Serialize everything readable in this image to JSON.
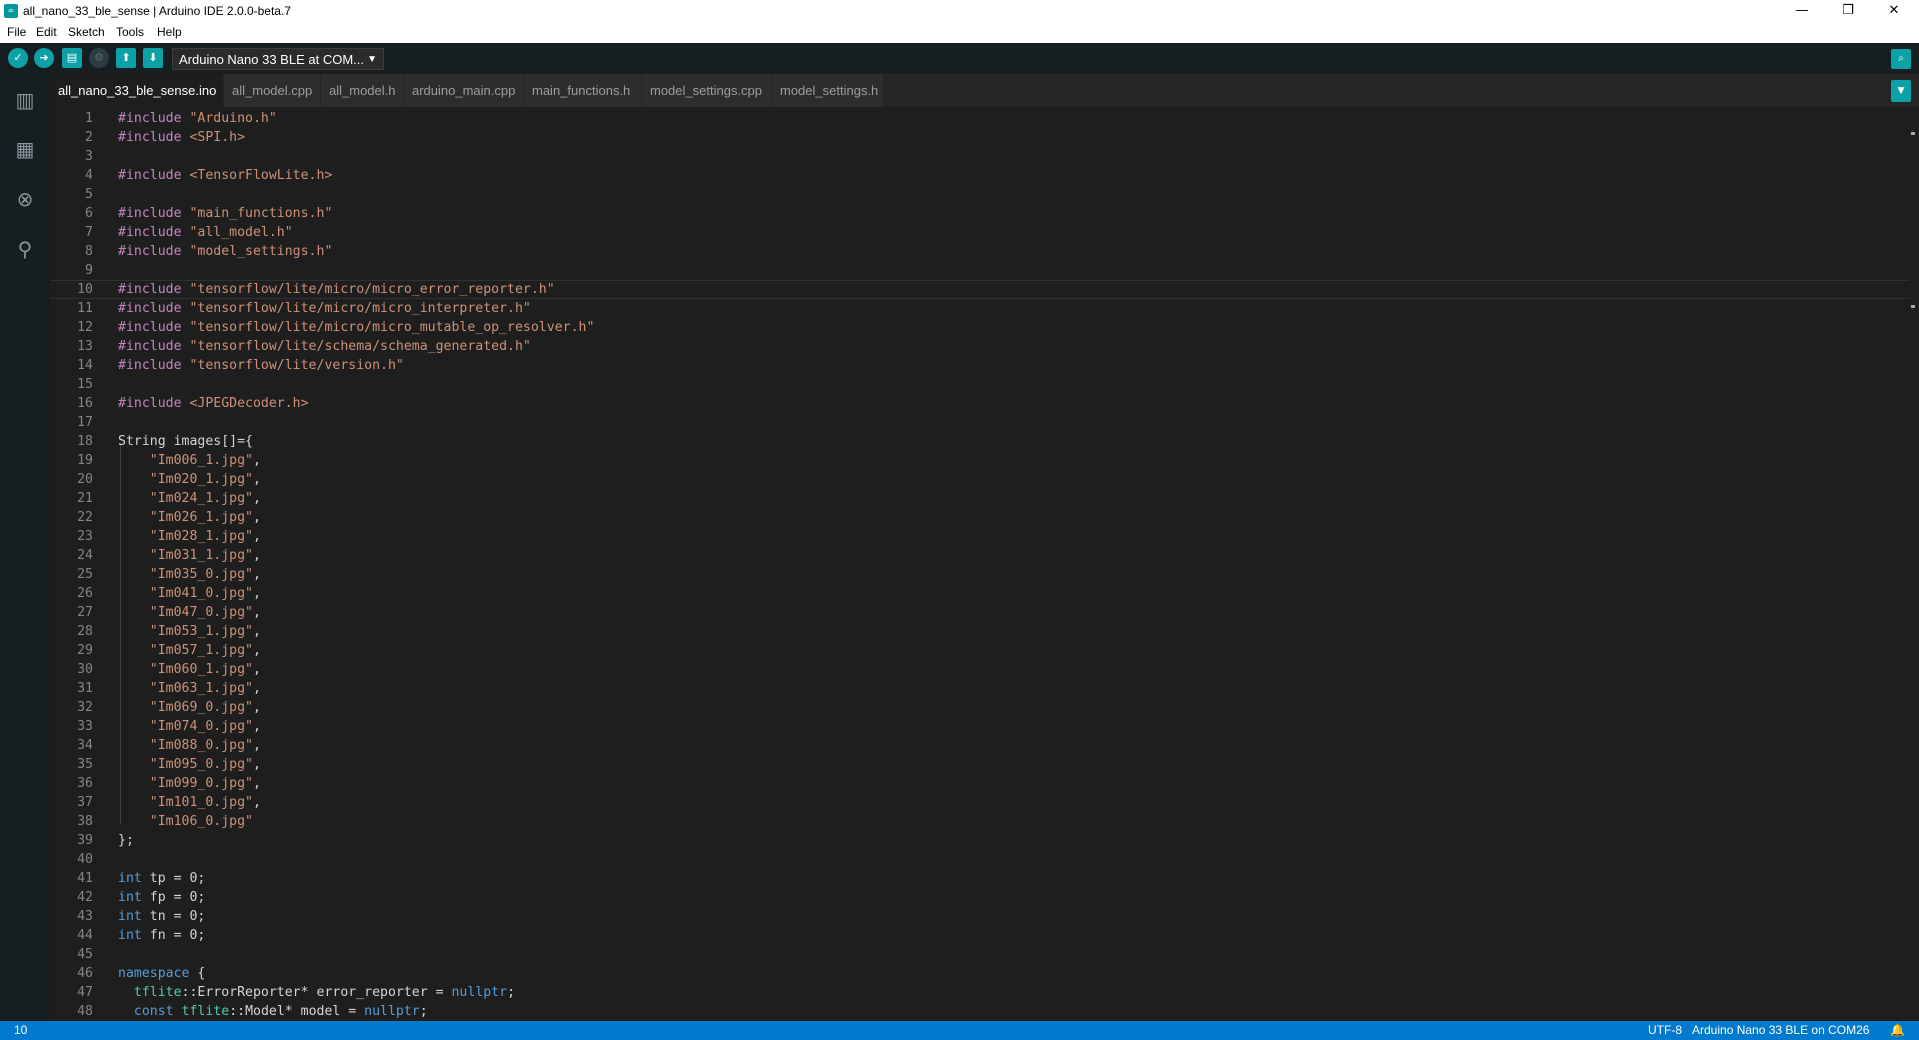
{
  "window": {
    "title": "all_nano_33_ble_sense | Arduino IDE 2.0.0-beta.7",
    "app_icon_text": "∞",
    "controls": [
      "—",
      "❐",
      "✕"
    ]
  },
  "menu": [
    "File",
    "Edit",
    "Sketch",
    "Tools",
    "Help"
  ],
  "toolbar": {
    "board_selector": "Arduino Nano 33 BLE at COM...",
    "caret": "▼"
  },
  "tabs": [
    {
      "label": "all_nano_33_ble_sense.ino",
      "active": true
    },
    {
      "label": "all_model.cpp",
      "active": false
    },
    {
      "label": "all_model.h",
      "active": false
    },
    {
      "label": "arduino_main.cpp",
      "active": false
    },
    {
      "label": "main_functions.h",
      "active": false
    },
    {
      "label": "model_settings.cpp",
      "active": false
    },
    {
      "label": "model_settings.h",
      "active": false
    }
  ],
  "editor": {
    "current_line": 10,
    "lines": [
      {
        "n": "1",
        "parts": [
          [
            "kw",
            "#include "
          ],
          [
            "str",
            "\"Arduino.h\""
          ]
        ]
      },
      {
        "n": "2",
        "parts": [
          [
            "kw",
            "#include "
          ],
          [
            "str",
            "<SPI.h>"
          ]
        ]
      },
      {
        "n": "3",
        "parts": []
      },
      {
        "n": "4",
        "parts": [
          [
            "kw",
            "#include "
          ],
          [
            "str",
            "<TensorFlowLite.h>"
          ]
        ]
      },
      {
        "n": "5",
        "parts": []
      },
      {
        "n": "6",
        "parts": [
          [
            "kw",
            "#include "
          ],
          [
            "str",
            "\"main_functions.h\""
          ]
        ]
      },
      {
        "n": "7",
        "parts": [
          [
            "kw",
            "#include "
          ],
          [
            "str",
            "\"all_model.h\""
          ]
        ]
      },
      {
        "n": "8",
        "parts": [
          [
            "kw",
            "#include "
          ],
          [
            "str",
            "\"model_settings.h\""
          ]
        ]
      },
      {
        "n": "9",
        "parts": []
      },
      {
        "n": "10",
        "parts": [
          [
            "kw",
            "#include "
          ],
          [
            "str",
            "\"tensorflow/lite/micro/micro_error_reporter.h\""
          ]
        ]
      },
      {
        "n": "11",
        "parts": [
          [
            "kw",
            "#include "
          ],
          [
            "str",
            "\"tensorflow/lite/micro/micro_interpreter.h\""
          ]
        ]
      },
      {
        "n": "12",
        "parts": [
          [
            "kw",
            "#include "
          ],
          [
            "str",
            "\"tensorflow/lite/micro/micro_mutable_op_resolver.h\""
          ]
        ]
      },
      {
        "n": "13",
        "parts": [
          [
            "kw",
            "#include "
          ],
          [
            "str",
            "\"tensorflow/lite/schema/schema_generated.h\""
          ]
        ]
      },
      {
        "n": "14",
        "parts": [
          [
            "kw",
            "#include "
          ],
          [
            "str",
            "\"tensorflow/lite/version.h\""
          ]
        ]
      },
      {
        "n": "15",
        "parts": []
      },
      {
        "n": "16",
        "parts": [
          [
            "kw",
            "#include "
          ],
          [
            "str",
            "<JPEGDecoder.h>"
          ]
        ]
      },
      {
        "n": "17",
        "parts": []
      },
      {
        "n": "18",
        "parts": [
          [
            "pl",
            "String images[]={"
          ]
        ]
      },
      {
        "n": "19",
        "parts": [
          [
            "pl",
            "    "
          ],
          [
            "str",
            "\"Im006_1.jpg\""
          ],
          [
            "pl",
            ","
          ]
        ]
      },
      {
        "n": "20",
        "parts": [
          [
            "pl",
            "    "
          ],
          [
            "str",
            "\"Im020_1.jpg\""
          ],
          [
            "pl",
            ","
          ]
        ]
      },
      {
        "n": "21",
        "parts": [
          [
            "pl",
            "    "
          ],
          [
            "str",
            "\"Im024_1.jpg\""
          ],
          [
            "pl",
            ","
          ]
        ]
      },
      {
        "n": "22",
        "parts": [
          [
            "pl",
            "    "
          ],
          [
            "str",
            "\"Im026_1.jpg\""
          ],
          [
            "pl",
            ","
          ]
        ]
      },
      {
        "n": "23",
        "parts": [
          [
            "pl",
            "    "
          ],
          [
            "str",
            "\"Im028_1.jpg\""
          ],
          [
            "pl",
            ","
          ]
        ]
      },
      {
        "n": "24",
        "parts": [
          [
            "pl",
            "    "
          ],
          [
            "str",
            "\"Im031_1.jpg\""
          ],
          [
            "pl",
            ","
          ]
        ]
      },
      {
        "n": "25",
        "parts": [
          [
            "pl",
            "    "
          ],
          [
            "str",
            "\"Im035_0.jpg\""
          ],
          [
            "pl",
            ","
          ]
        ]
      },
      {
        "n": "26",
        "parts": [
          [
            "pl",
            "    "
          ],
          [
            "str",
            "\"Im041_0.jpg\""
          ],
          [
            "pl",
            ","
          ]
        ]
      },
      {
        "n": "27",
        "parts": [
          [
            "pl",
            "    "
          ],
          [
            "str",
            "\"Im047_0.jpg\""
          ],
          [
            "pl",
            ","
          ]
        ]
      },
      {
        "n": "28",
        "parts": [
          [
            "pl",
            "    "
          ],
          [
            "str",
            "\"Im053_1.jpg\""
          ],
          [
            "pl",
            ","
          ]
        ]
      },
      {
        "n": "29",
        "parts": [
          [
            "pl",
            "    "
          ],
          [
            "str",
            "\"Im057_1.jpg\""
          ],
          [
            "pl",
            ","
          ]
        ]
      },
      {
        "n": "30",
        "parts": [
          [
            "pl",
            "    "
          ],
          [
            "str",
            "\"Im060_1.jpg\""
          ],
          [
            "pl",
            ","
          ]
        ]
      },
      {
        "n": "31",
        "parts": [
          [
            "pl",
            "    "
          ],
          [
            "str",
            "\"Im063_1.jpg\""
          ],
          [
            "pl",
            ","
          ]
        ]
      },
      {
        "n": "32",
        "parts": [
          [
            "pl",
            "    "
          ],
          [
            "str",
            "\"Im069_0.jpg\""
          ],
          [
            "pl",
            ","
          ]
        ]
      },
      {
        "n": "33",
        "parts": [
          [
            "pl",
            "    "
          ],
          [
            "str",
            "\"Im074_0.jpg\""
          ],
          [
            "pl",
            ","
          ]
        ]
      },
      {
        "n": "34",
        "parts": [
          [
            "pl",
            "    "
          ],
          [
            "str",
            "\"Im088_0.jpg\""
          ],
          [
            "pl",
            ","
          ]
        ]
      },
      {
        "n": "35",
        "parts": [
          [
            "pl",
            "    "
          ],
          [
            "str",
            "\"Im095_0.jpg\""
          ],
          [
            "pl",
            ","
          ]
        ]
      },
      {
        "n": "36",
        "parts": [
          [
            "pl",
            "    "
          ],
          [
            "str",
            "\"Im099_0.jpg\""
          ],
          [
            "pl",
            ","
          ]
        ]
      },
      {
        "n": "37",
        "parts": [
          [
            "pl",
            "    "
          ],
          [
            "str",
            "\"Im101_0.jpg\""
          ],
          [
            "pl",
            ","
          ]
        ]
      },
      {
        "n": "38",
        "parts": [
          [
            "pl",
            "    "
          ],
          [
            "str",
            "\"Im106_0.jpg\""
          ]
        ]
      },
      {
        "n": "39",
        "parts": [
          [
            "pl",
            "};"
          ]
        ]
      },
      {
        "n": "40",
        "parts": []
      },
      {
        "n": "41",
        "parts": [
          [
            "type",
            "int"
          ],
          [
            "pl",
            " tp = 0;"
          ]
        ]
      },
      {
        "n": "42",
        "parts": [
          [
            "type",
            "int"
          ],
          [
            "pl",
            " fp = 0;"
          ]
        ]
      },
      {
        "n": "43",
        "parts": [
          [
            "type",
            "int"
          ],
          [
            "pl",
            " tn = 0;"
          ]
        ]
      },
      {
        "n": "44",
        "parts": [
          [
            "type",
            "int"
          ],
          [
            "pl",
            " fn = 0;"
          ]
        ]
      },
      {
        "n": "45",
        "parts": []
      },
      {
        "n": "46",
        "parts": [
          [
            "type",
            "namespace"
          ],
          [
            "pl",
            " {"
          ]
        ]
      },
      {
        "n": "47",
        "parts": [
          [
            "pl",
            "  "
          ],
          [
            "ns",
            "tflite"
          ],
          [
            "pl",
            "::ErrorReporter* error_reporter = "
          ],
          [
            "type",
            "nullptr"
          ],
          [
            "pl",
            ";"
          ]
        ]
      },
      {
        "n": "48",
        "parts": [
          [
            "pl",
            "  "
          ],
          [
            "type",
            "const"
          ],
          [
            "pl",
            " "
          ],
          [
            "ns",
            "tflite"
          ],
          [
            "pl",
            "::Model* model = "
          ],
          [
            "type",
            "nullptr"
          ],
          [
            "pl",
            ";"
          ]
        ]
      }
    ]
  },
  "statusbar": {
    "line": "10",
    "encoding": "UTF-8",
    "board": "Arduino Nano 33 BLE on COM26",
    "bell": "🔔"
  },
  "icons": {
    "verify": "✓",
    "upload": "➜",
    "new": "▤",
    "debug": "⚙",
    "open": "⬆",
    "save": "⬇",
    "serial_monitor": "⌕",
    "tab_menu": "▼",
    "sketchbook": "▥",
    "boards": "▦",
    "debugger": "⊗",
    "search": "⚲"
  }
}
